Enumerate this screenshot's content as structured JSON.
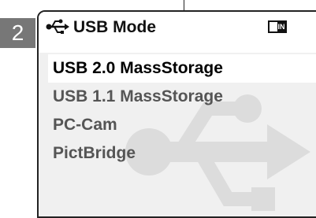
{
  "step": {
    "number": "2"
  },
  "header": {
    "icon": "usb-icon",
    "title": "USB Mode",
    "memory_icon": "internal-memory-icon",
    "memory_label": "IN"
  },
  "menu": {
    "items": [
      {
        "label": "USB 2.0 MassStorage",
        "selected": true
      },
      {
        "label": "USB 1.1 MassStorage",
        "selected": false
      },
      {
        "label": "PC-Cam",
        "selected": false
      },
      {
        "label": "PictBridge",
        "selected": false
      }
    ]
  },
  "colors": {
    "badge_bg": "#777777",
    "menu_bg": "#f0f0f0",
    "selected_bg": "#ffffff",
    "selected_text": "#000000",
    "item_text": "#555555",
    "watermark": "#dcdcdc"
  }
}
